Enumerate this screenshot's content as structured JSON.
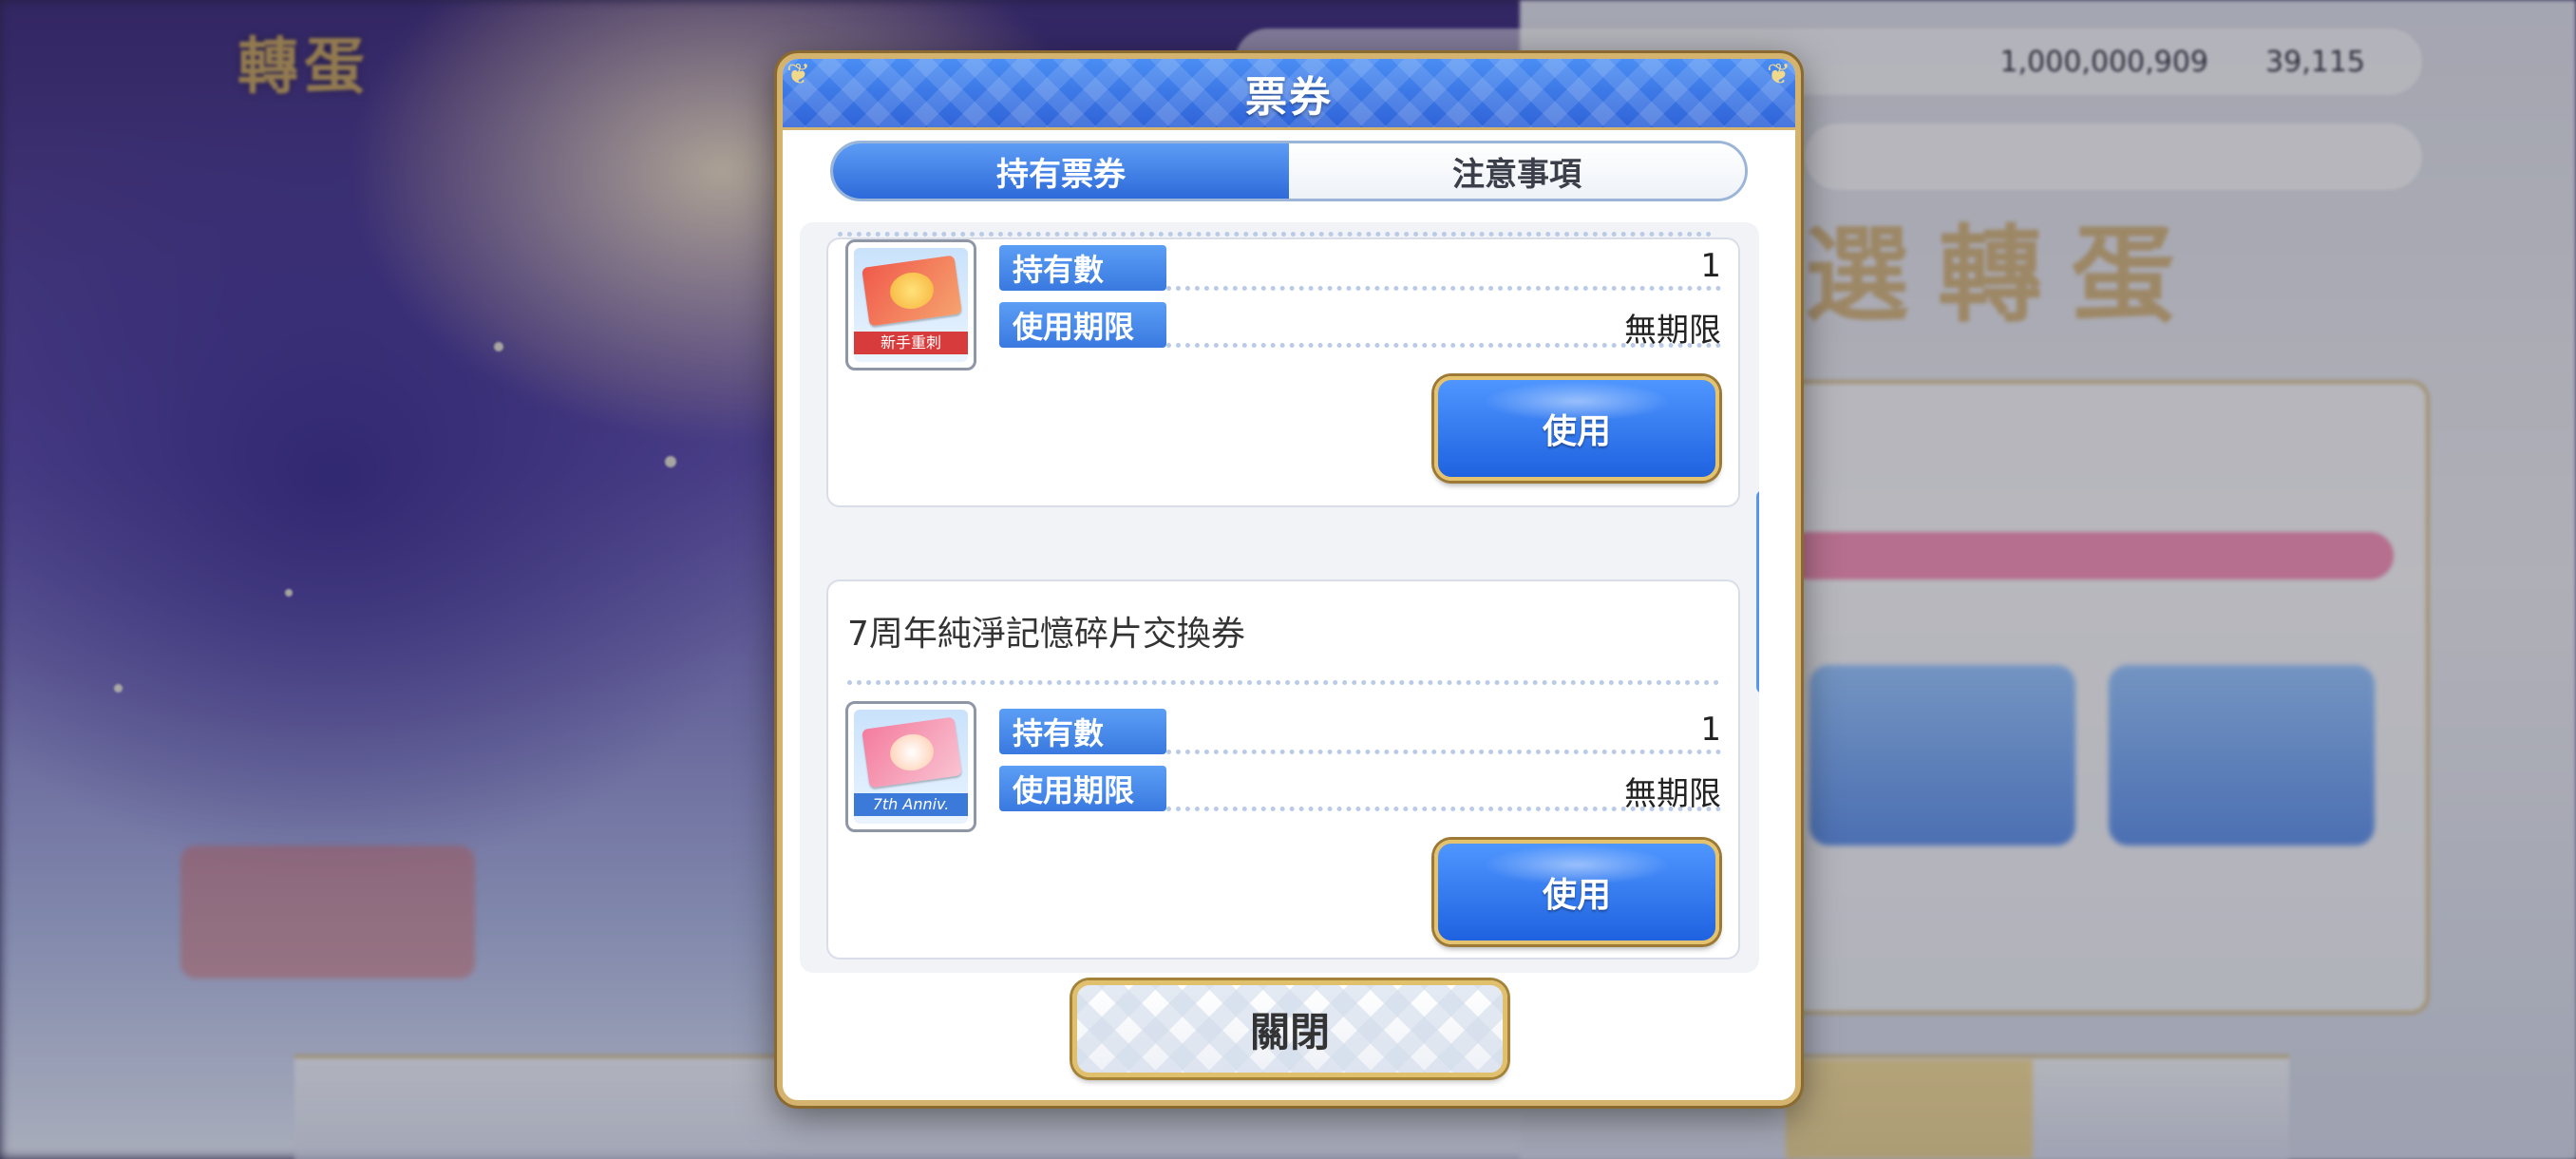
{
  "background": {
    "screen_title": "轉蛋",
    "currency": [
      "1,000,000,909",
      "39,115"
    ],
    "banner_title": "選轉蛋"
  },
  "modal": {
    "title": "票券",
    "tabs": [
      {
        "label": "持有票券",
        "active": true
      },
      {
        "label": "注意事項",
        "active": false
      }
    ],
    "tickets": [
      {
        "name": "",
        "icon": "newbie-ticket-icon",
        "icon_caption": "新手重刺",
        "owned_label": "持有數",
        "owned_value": "1",
        "expiry_label": "使用期限",
        "expiry_value": "無期限",
        "use_label": "使用"
      },
      {
        "name": "7周年純淨記憶碎片交換券",
        "icon": "anniversary-ticket-icon",
        "icon_caption": "7th Anniv.",
        "owned_label": "持有數",
        "owned_value": "1",
        "expiry_label": "使用期限",
        "expiry_value": "無期限",
        "use_label": "使用"
      }
    ],
    "close_label": "關閉"
  },
  "colors": {
    "accent_blue": "#2f63d8",
    "gold_border": "#d4b36e"
  }
}
